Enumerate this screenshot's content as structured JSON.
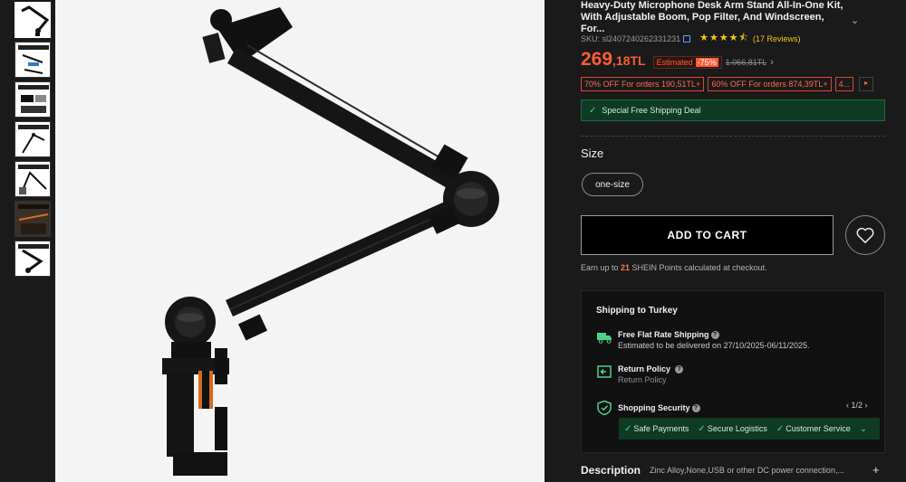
{
  "thumbnails": [
    {
      "label": "",
      "active": true
    },
    {
      "label": "",
      "active": false
    },
    {
      "label": "",
      "active": false
    },
    {
      "label": "",
      "active": false
    },
    {
      "label": "",
      "active": false
    },
    {
      "label": "",
      "active": false
    },
    {
      "label": "",
      "active": false
    }
  ],
  "product": {
    "title": "Heavy-Duty Microphone Desk Arm Stand All-In-One Kit, With Adjustable Boom, Pop Filter, And Windscreen, For...",
    "sku": "SKU: sl2407240262331231",
    "rating": 4.5,
    "reviews": "(17 Reviews)"
  },
  "price": {
    "integer": "269",
    "decimal": ",18TL",
    "estimated_label": "Estimated",
    "discount": "-75%",
    "original": "1.066,81TL"
  },
  "promos": [
    "70% OFF For orders 190,51TL+",
    "60% OFF For orders 874,39TL+",
    "4..."
  ],
  "shipping_deal": "Special Free Shipping Deal",
  "size": {
    "label": "Size",
    "option": "one-size"
  },
  "actions": {
    "add_to_cart": "ADD TO CART"
  },
  "points": {
    "prefix": "Earn up to ",
    "amount": "21",
    "suffix": " SHEIN Points calculated at checkout."
  },
  "shipping_box": {
    "title": "Shipping to Turkey",
    "free_flat": "Free Flat Rate Shipping",
    "estimated": "Estimated to be delivered on 27/10/2025-06/11/2025.",
    "return_title": "Return Policy",
    "return_sub": "Return Policy",
    "security_title": "Shopping Security",
    "pager": "1/2",
    "security_items": [
      "Safe Payments",
      "Secure Logistics",
      "Customer Service"
    ]
  },
  "description": {
    "label": "Description",
    "text": "Zinc Alloy,None,USB or other DC power connection,..."
  },
  "colors": {
    "price": "#ff5c35",
    "deal_bg": "#0f3a24",
    "accent_green": "#4fd18b",
    "star": "#f5c518"
  }
}
